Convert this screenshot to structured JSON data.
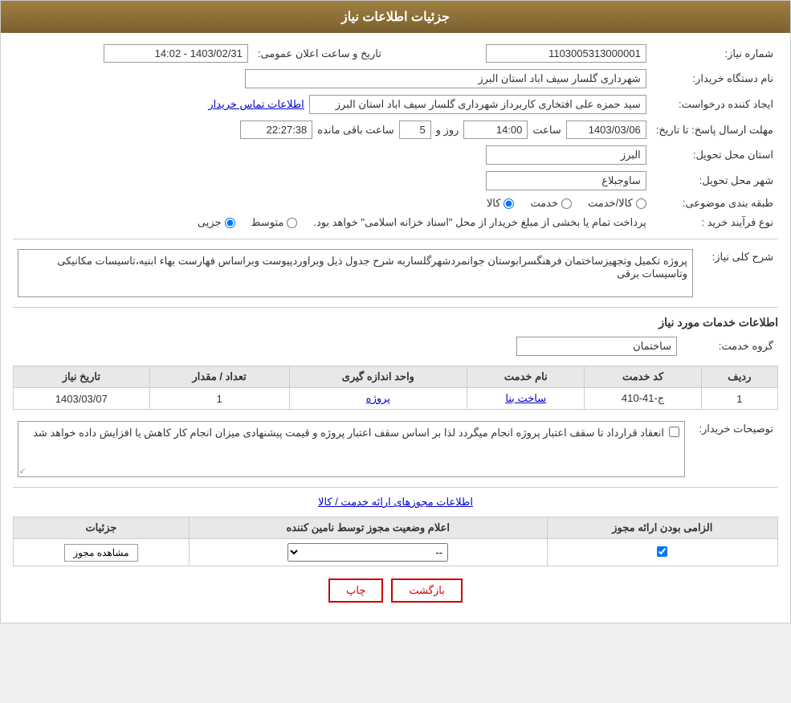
{
  "page": {
    "title": "جزئیات اطلاعات نیاز",
    "header": {
      "label_need_number": "شماره نیاز:",
      "need_number": "1103005313000001",
      "label_public_announce": "تاریخ و ساعت اعلان عمومی:",
      "public_announce_date": "1403/02/31 - 14:02",
      "label_buyer_org": "نام دستگاه خریدار:",
      "buyer_org": "شهرداری گلسار سیف اباد استان البرز",
      "label_creator": "ایجاد کننده درخواست:",
      "creator": "سید حمزه علی افتخاری کاربرداز شهرداری گلسار سیف اباد استان البرز",
      "contact_link": "اطلاعات تماس خریدار",
      "label_response_deadline": "مهلت ارسال پاسخ: تا تاریخ:",
      "response_date": "1403/03/06",
      "response_time_label": "ساعت",
      "response_time": "14:00",
      "response_day_label": "روز و",
      "response_days": "5",
      "response_remaining_label": "ساعت باقی مانده",
      "response_remaining": "22:27:38",
      "label_province": "استان محل تحویل:",
      "province": "البرز",
      "label_city": "شهر محل تحویل:",
      "city": "ساوجبلاغ",
      "label_category": "طبقه بندی موضوعی:",
      "category_options": [
        "کالا",
        "خدمت",
        "کالا/خدمت"
      ],
      "category_selected": "کالا",
      "label_purchase_type": "نوع فرآیند خرید :",
      "purchase_type_options": [
        "جزیی",
        "متوسط"
      ],
      "purchase_type_note": "پرداخت تمام یا بخشی از مبلغ خریدار از محل \"اسناد خزانه اسلامی\" خواهد بود.",
      "label_need_description": "شرح کلی نیاز:",
      "need_description_text": "پروژه تکمیل وتجهیزساختمان فرهنگسرابوستان جوانمردشهرگلساربه شرح جدول ذیل وبراوردپیوست وبراساس فهارست بهاء ابنیه،تاسیسات مکانیکی وتاسیسات برقی"
    },
    "services_section": {
      "title": "اطلاعات خدمات مورد نیاز",
      "label_service_group": "گروه خدمت:",
      "service_group": "ساختمان",
      "table_headers": [
        "ردیف",
        "کد خدمت",
        "نام خدمت",
        "واحد اندازه گیری",
        "تعداد / مقدار",
        "تاریخ نیاز"
      ],
      "table_rows": [
        {
          "row": "1",
          "service_code": "ج-41-410",
          "service_name": "ساخت بنا",
          "unit": "پروژه",
          "quantity": "1",
          "need_date": "1403/03/07"
        }
      ]
    },
    "buyer_notes_section": {
      "label": "توصیحات خریدار:",
      "notes": "انعقاد قرارداد تا سقف اعتبار پروژه انجام میگردد لذا بر اساس سقف اعتبار پروژه و قیمت پیشنهادی میزان انجام کار کاهش یا افزایش داده خواهد شد"
    },
    "permits_section": {
      "title": "اطلاعات مجوزهای ارائه خدمت / کالا",
      "table_headers": [
        "الزامی بودن ارائه مجوز",
        "اعلام وضعیت مجوز توسط نامین کننده",
        "جزئیات"
      ],
      "table_rows": [
        {
          "required": true,
          "status": "--",
          "details_btn": "مشاهده مجوز"
        }
      ]
    },
    "buttons": {
      "print": "چاپ",
      "back": "بازگشت"
    }
  }
}
